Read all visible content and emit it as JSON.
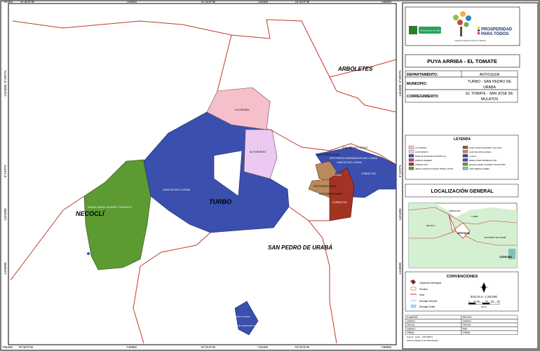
{
  "coords": {
    "top": [
      "736400",
      "76°30'0\"W",
      "740900",
      "76°25'0\"W",
      "743400",
      "76°20'0\"W",
      "748900"
    ],
    "bottom": [
      "736400",
      "76°30'0\"W",
      "740900",
      "76°25'0\"W",
      "743400",
      "76°20'0\"W",
      "748900"
    ],
    "left": [
      "1424000",
      "8°20'0\"N",
      "1421000",
      "8°15'0\"N",
      "1418000"
    ],
    "right": [
      "1424000",
      "8°20'0\"N",
      "1421000",
      "8°15'0\"N",
      "1418000"
    ]
  },
  "places": {
    "arboletes": "ARBOLETES",
    "turbo": "TURBO",
    "necocli": "NECOCLÍ",
    "san_pedro": "SAN PEDRO DE URABÁ"
  },
  "parcels": {
    "la_corona": "LA CORONA",
    "alto_bonito": "ALTO BONITO",
    "juan_de_dios": "JUAN DE DIOS LOZADA",
    "miguel_angel": "MIGUEL ANGEL ALVAREZ \"CAUNETO\"",
    "san_pedro_sur_a": "JUAN DE DIOS LOZADA",
    "san_pedro_sur_b": "SAN FRANCISCO TORRES",
    "east_1": "JUAN DE DIOS LOZADA",
    "east_2": "SOR TERESA GOMEZ",
    "east_3": "SOR TERESA GOMEZ",
    "east_4": "JUAN DE DIOS LOZADA",
    "east_5": "LA ISLA",
    "east_6": "CORRALITOS",
    "east_7": "JUAN DE DIOS LOZADA",
    "east_8": "SOR TERESA GOMEZ",
    "east_9": "SOR TERESA GOMEZ",
    "east_10": "CORRALITOS"
  },
  "panel": {
    "logo_1": "Gobernación de Antioquia",
    "logo_2": "UNIDAD DE RESTITUCIÓN DE TIERRAS",
    "logo_3_line1": "PROSPERIDAD",
    "logo_3_line2": "PARA TODOS",
    "title": "PUYA ARRIBA - EL TOMATE",
    "info": [
      {
        "label": "DEPARTAMENTO:",
        "value": "ANTIOQUIA"
      },
      {
        "label": "MUNICIPIO:",
        "value": "TURBO - SAN PEDRO DE URABA"
      },
      {
        "label": "CORREGIMIENTO:",
        "value": "EL TOMATE - SAN JOSE DE MULATOS"
      }
    ],
    "legend_title": "LEYENDA",
    "legend_left": [
      {
        "label": "LA CORONA",
        "color": "#f6c0cb"
      },
      {
        "label": "ALTO BONITO",
        "color": "#ebc9f0"
      },
      {
        "label": "MARLON ELIECER CASTAÑO GIL",
        "color": "#3a4fae"
      },
      {
        "label": "MARINO PEREIRA",
        "color": "#b33d8b"
      },
      {
        "label": "CORRALITOS",
        "color": "#a33424"
      },
      {
        "label": "JESUS IGNACIO POSADA \"BORO LATON\"",
        "color": "#5c9a32"
      }
    ],
    "legend_right": [
      {
        "label": "JUAN CARLOS SUAREZ \"CALICHO\"",
        "color": "#8a5a2b"
      },
      {
        "label": "JUAN DE DIOS LOZADA",
        "color": "#b98a5c"
      },
      {
        "label": "LA ISLA",
        "color": "#3c3f95"
      },
      {
        "label": "MARIA JANET BURBANO ORJ",
        "color": "#5b4a9a"
      },
      {
        "label": "MIGUEL ANGEL ALVAREZ \"PUCHONTE\"",
        "color": "#7a8c2a"
      },
      {
        "label": "SOR TERESA GOMEZ",
        "color": "#7ec3b8"
      }
    ],
    "loc_title": "LOCALIZACIÓN GENERAL",
    "minimap_labels": {
      "a": "ARBOLETES",
      "b": "TURBO",
      "c": "NECOCLÍ",
      "d": "SAN PEDRO DE URABÁ",
      "e": "ANTIOQUIA",
      "f": "CÓRDOBA"
    },
    "conv_title": "CONVENCIONES",
    "conv_items": [
      {
        "label": "Cabecera Municipal"
      },
      {
        "label": "Predios"
      },
      {
        "label": "Vías"
      },
      {
        "label": "Drenaje Sencillo"
      },
      {
        "label": "Drenaje Doble"
      }
    ],
    "scale_label": "ESCALA: 1:25.000",
    "scale_ticks": [
      "0",
      "100 200",
      "400",
      "600",
      "800"
    ],
    "scale_unit": "Metros",
    "footer_rows": [
      {
        "l": "ELABORÓ:",
        "r": "REVISÓ:"
      },
      {
        "l": "CARGO:",
        "r": "CARGO:"
      },
      {
        "l": "FECHA:",
        "r": "FECHA:"
      },
      {
        "l": "CARGO:",
        "r": "REF:"
      },
      {
        "l": "FIRMA:",
        "r": "FIRMA:"
      }
    ],
    "source_line1": "Fuente : IGAC - URT/SRTG",
    "source_line2": "Sistema Magna Colombia Bogotá"
  }
}
